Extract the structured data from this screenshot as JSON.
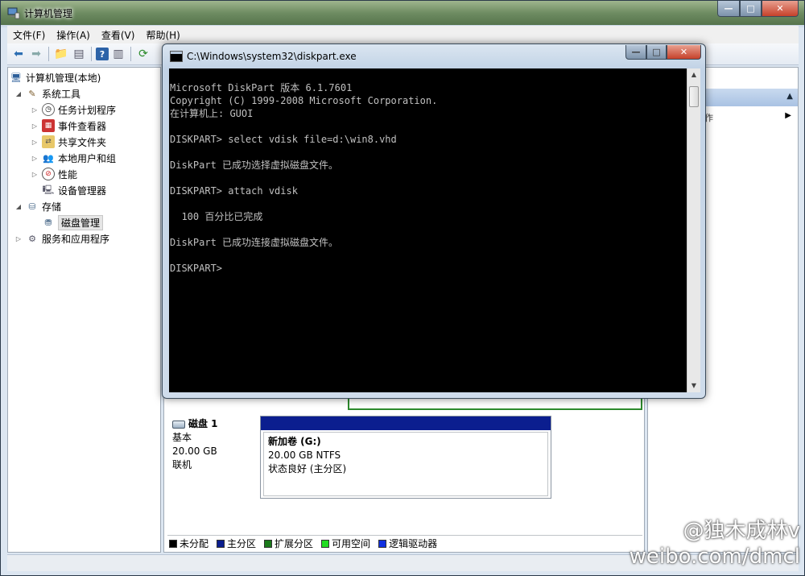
{
  "mmc": {
    "title": "计算机管理",
    "menu": [
      "文件(F)",
      "操作(A)",
      "查看(V)",
      "帮助(H)"
    ],
    "caption_buttons": {
      "minimize": "—",
      "maximize": "□",
      "close": "✕"
    }
  },
  "tree": {
    "items": [
      {
        "label": "计算机管理(本地)",
        "icon": "computer-management-icon",
        "expander": ""
      },
      {
        "label": "系统工具",
        "icon": "tools-icon",
        "expander": "◢"
      },
      {
        "label": "任务计划程序",
        "icon": "clock-icon",
        "expander": "▷"
      },
      {
        "label": "事件查看器",
        "icon": "event-viewer-icon",
        "expander": "▷"
      },
      {
        "label": "共享文件夹",
        "icon": "shared-folder-icon",
        "expander": "▷"
      },
      {
        "label": "本地用户和组",
        "icon": "users-icon",
        "expander": "▷"
      },
      {
        "label": "性能",
        "icon": "performance-icon",
        "expander": "▷"
      },
      {
        "label": "设备管理器",
        "icon": "device-manager-icon",
        "expander": ""
      },
      {
        "label": "存储",
        "icon": "storage-icon",
        "expander": "◢"
      },
      {
        "label": "磁盘管理",
        "icon": "disk-management-icon",
        "expander": ""
      },
      {
        "label": "服务和应用程序",
        "icon": "services-icon",
        "expander": "▷"
      }
    ]
  },
  "disk": {
    "title": "磁盘 1",
    "type": "基本",
    "size": "20.00 GB",
    "status": "联机",
    "volume": {
      "name": "新加卷  (G:)",
      "size_fs": "20.00 GB NTFS",
      "health": "状态良好 (主分区)"
    }
  },
  "legend": [
    {
      "label": "未分配",
      "color": "#000000"
    },
    {
      "label": "主分区",
      "color": "#0b1e8f"
    },
    {
      "label": "扩展分区",
      "color": "#1b7a1b"
    },
    {
      "label": "可用空间",
      "color": "#22dd22"
    },
    {
      "label": "逻辑驱动器",
      "color": "#1030e0"
    }
  ],
  "actions": {
    "sub_label": "作"
  },
  "console": {
    "title": "C:\\Windows\\system32\\diskpart.exe",
    "lines": [
      "Microsoft DiskPart 版本 6.1.7601",
      "Copyright (C) 1999-2008 Microsoft Corporation.",
      "在计算机上: GUOI",
      "",
      "DISKPART> select vdisk file=d:\\win8.vhd",
      "",
      "DiskPart 已成功选择虚拟磁盘文件。",
      "",
      "DISKPART> attach vdisk",
      "",
      "  100 百分比已完成",
      "",
      "DiskPart 已成功连接虚拟磁盘文件。",
      "",
      "DISKPART>"
    ],
    "caption_buttons": {
      "minimize": "—",
      "maximize": "□",
      "close": "✕"
    }
  },
  "watermark": {
    "line1": "@独木成林v",
    "line2": "weibo.com/dmcl"
  },
  "colors": {
    "console_bg": "#000000",
    "console_text": "#c0c0c0",
    "primary_partition": "#0b1e8f"
  }
}
